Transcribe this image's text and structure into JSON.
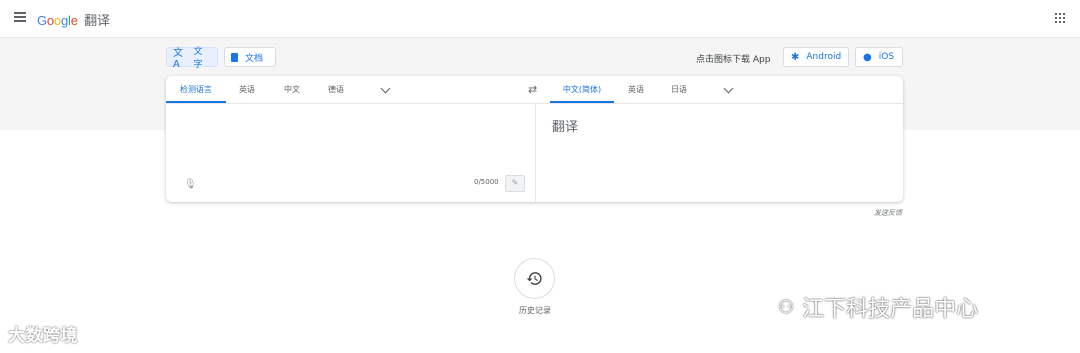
{
  "header": {
    "logo_letters": [
      "G",
      "o",
      "o",
      "g",
      "l",
      "e"
    ],
    "product": "翻译"
  },
  "modes": {
    "text": "文字",
    "document": "文档"
  },
  "download": {
    "text": "点击图标下载 App",
    "android": "Android",
    "ios": "iOS"
  },
  "source_langs": [
    "检测语言",
    "英语",
    "中文",
    "德语"
  ],
  "target_langs": [
    "中文(简体)",
    "英语",
    "日语"
  ],
  "source": {
    "value": "",
    "counter": "0/5000"
  },
  "output": {
    "text": "翻译"
  },
  "feedback": "发送反馈",
  "history": {
    "label": "历史记录"
  },
  "watermarks": {
    "left": "大数跨境",
    "right": "江下科技产品中心"
  },
  "colors": {
    "accent": "#1a73e8",
    "band": "#f5f5f5"
  },
  "icons": {
    "menu": "menu-icon",
    "apps": "apps-grid-icon",
    "translate": "translate-icon",
    "document": "document-icon",
    "android": "android-icon",
    "apple": "apple-icon",
    "swap": "swap-icon",
    "mic": "microphone-icon",
    "edit": "pencil-icon",
    "history": "history-icon"
  }
}
